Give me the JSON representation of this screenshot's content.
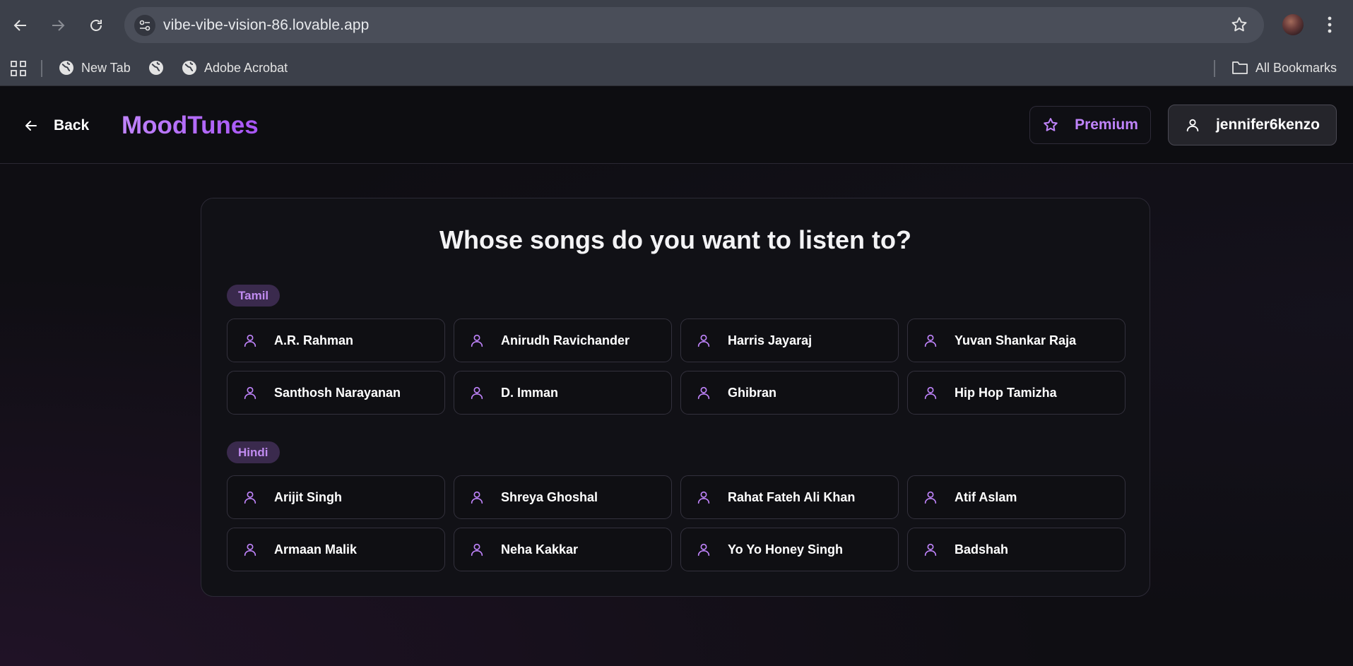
{
  "browser": {
    "url": "vibe-vibe-vision-86.lovable.app",
    "bookmarks": [
      {
        "label": "New Tab"
      },
      {
        "label": ""
      },
      {
        "label": "Adobe Acrobat"
      }
    ],
    "all_bookmarks_label": "All Bookmarks"
  },
  "header": {
    "back_label": "Back",
    "brand": "MoodTunes",
    "premium_label": "Premium",
    "username": "jennifer6kenzo",
    "colors": {
      "accent": "#c084fc"
    }
  },
  "main": {
    "title": "Whose songs do you want to listen to?",
    "groups": [
      {
        "language": "Tamil",
        "artists": [
          "A.R. Rahman",
          "Anirudh Ravichander",
          "Harris Jayaraj",
          "Yuvan Shankar Raja",
          "Santhosh Narayanan",
          "D. Imman",
          "Ghibran",
          "Hip Hop Tamizha"
        ]
      },
      {
        "language": "Hindi",
        "artists": [
          "Arijit Singh",
          "Shreya Ghoshal",
          "Rahat Fateh Ali Khan",
          "Atif Aslam",
          "Armaan Malik",
          "Neha Kakkar",
          "Yo Yo Honey Singh",
          "Badshah"
        ]
      }
    ]
  }
}
